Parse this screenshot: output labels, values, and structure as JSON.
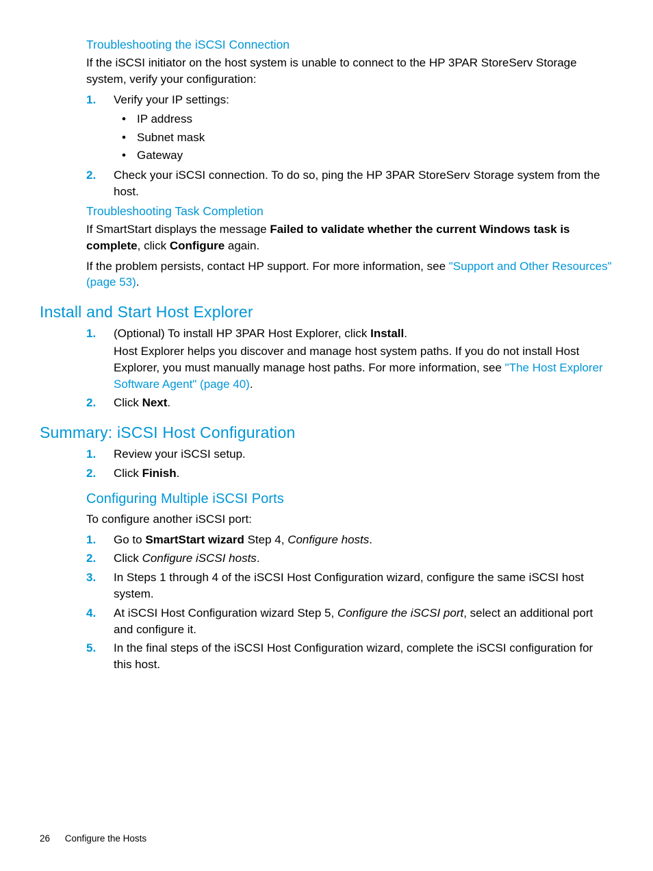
{
  "section1": {
    "h4": "Troubleshooting the iSCSI Connection",
    "intro": "If the iSCSI initiator on the host system is unable to connect to the HP 3PAR StoreServ Storage system, verify your configuration:",
    "step1": "Verify your IP settings:",
    "bullets": [
      "IP address",
      "Subnet mask",
      "Gateway"
    ],
    "step2": "Check your iSCSI connection. To do so, ping the HP 3PAR StoreServ Storage system from the host."
  },
  "section2": {
    "h4": "Troubleshooting Task Completion",
    "p1_a": "If SmartStart displays the message ",
    "p1_bold": "Failed to validate whether the current Windows task is complete",
    "p1_b": ", click ",
    "p1_bold2": "Configure",
    "p1_c": " again.",
    "p2_a": "If the problem persists, contact HP support. For more information, see ",
    "p2_link": "\"Support and Other Resources\" (page 53)",
    "p2_b": "."
  },
  "section3": {
    "h2": "Install and Start Host Explorer",
    "step1_a": "(Optional) To install HP 3PAR Host Explorer, click ",
    "step1_bold": "Install",
    "step1_b": ".",
    "step1_p_a": "Host Explorer helps you discover and manage host system paths. If you do not install Host Explorer, you must manually manage host paths. For more information, see ",
    "step1_p_link": "\"The Host Explorer Software Agent\" (page 40)",
    "step1_p_b": ".",
    "step2_a": "Click ",
    "step2_bold": "Next",
    "step2_b": "."
  },
  "section4": {
    "h2": "Summary: iSCSI Host Configuration",
    "step1": "Review your iSCSI setup.",
    "step2_a": "Click ",
    "step2_bold": "Finish",
    "step2_b": "."
  },
  "section5": {
    "h3": "Configuring Multiple iSCSI Ports",
    "intro": "To configure another iSCSI port:",
    "step1_a": "Go to ",
    "step1_bold": "SmartStart wizard",
    "step1_b": " Step 4, ",
    "step1_ital": "Configure hosts",
    "step1_c": ".",
    "step2_a": "Click ",
    "step2_ital": "Configure iSCSI hosts",
    "step2_b": ".",
    "step3": "In Steps 1 through 4 of the iSCSI Host Configuration wizard, configure the same iSCSI host system.",
    "step4_a": "At iSCSI Host Configuration wizard Step 5, ",
    "step4_ital": "Configure the iSCSI port",
    "step4_b": ", select an additional port and configure it.",
    "step5": "In the final steps of the iSCSI Host Configuration wizard, complete the iSCSI configuration for this host."
  },
  "footer": {
    "page": "26",
    "title": "Configure the Hosts"
  },
  "nums": [
    "1.",
    "2.",
    "3.",
    "4.",
    "5."
  ]
}
